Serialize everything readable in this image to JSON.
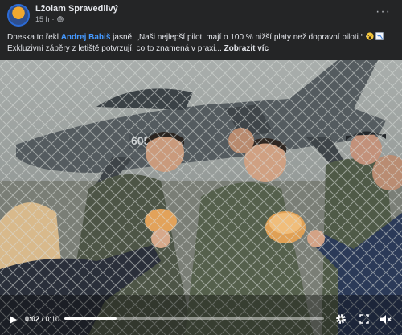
{
  "post": {
    "author": "Lžolam Spravedlivý",
    "time": "15 h",
    "dot": "·",
    "more_label": "···",
    "text_before": "Dneska to řekl ",
    "mention": "Andrej Babiš",
    "text_after": " jasně: „Naši nejlepší piloti mají o 100 % nižší platy než dopravní piloti.“ ",
    "text_line2": "Exkluzivní záběry z letiště potvrzují, co to znamená v praxi... ",
    "see_more": "Zobrazit víc"
  },
  "video": {
    "tail_number": "6054",
    "current_time": "0:02",
    "separator": " / ",
    "duration": "0:10",
    "progress_fraction": 0.2
  },
  "colors": {
    "background": "#242526",
    "mention": "#4599ff",
    "text": "#e4e6eb",
    "muted": "#b0b3b8"
  },
  "icons": [
    "globe-icon",
    "more-options-icon",
    "scream-emoji-icon",
    "chart-emoji-icon",
    "play-icon",
    "settings-icon",
    "volume-muted-icon"
  ]
}
